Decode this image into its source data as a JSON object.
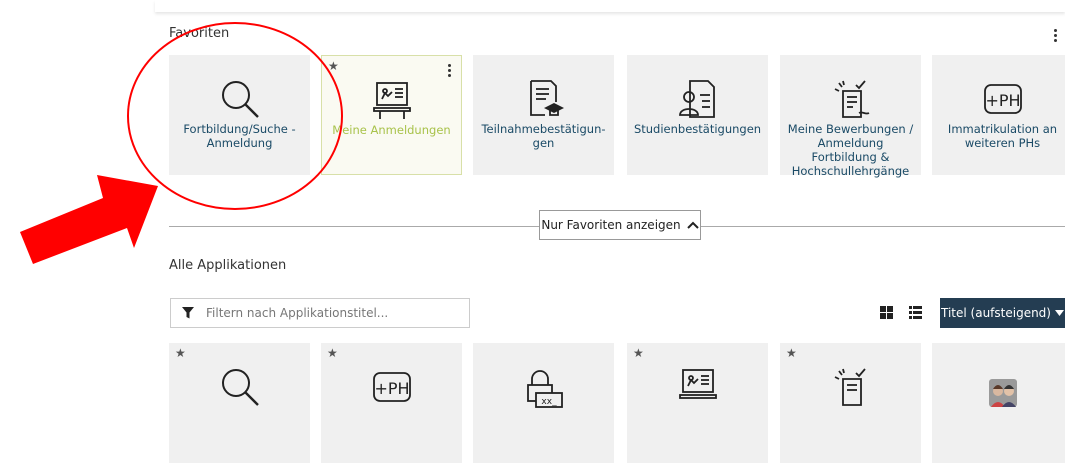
{
  "favorites": {
    "title": "Favoriten",
    "tiles": [
      {
        "label": "Fortbildung/Suche - An­meldung",
        "icon": "magnifier-icon"
      },
      {
        "label": "Meine Anmeldungen",
        "icon": "presentation-board-icon"
      },
      {
        "label": "Teilnahmebestätigun­gen",
        "icon": "document-graduation-icon"
      },
      {
        "label": "Studienbestätigungen",
        "icon": "document-person-icon"
      },
      {
        "label": "Meine Bewerbungen / Anmeldung Fortbildung & Hochschullehrgänge",
        "icon": "application-hand-icon"
      },
      {
        "label": "Immatrikulation an weiteren PHs",
        "icon": "ph-plus-icon"
      }
    ],
    "toggle_label": "Nur Favoriten anzeigen"
  },
  "all_apps": {
    "title": "Alle Applikationen",
    "filter_placeholder": "Filtern nach Applikationstitel...",
    "sort_label": "Titel (aufsteigend)",
    "tiles": [
      {
        "icon": "magnifier-icon"
      },
      {
        "icon": "ph-plus-icon"
      },
      {
        "icon": "lock-password-icon"
      },
      {
        "icon": "presentation-board-icon"
      },
      {
        "icon": "application-hand-icon"
      },
      {
        "icon": "user-avatars-icon"
      }
    ]
  },
  "colors": {
    "accent": "#243d52",
    "tile_bg": "#f0f0f0",
    "label": "#1a4a66",
    "highlight": "#ff0000",
    "active_label": "#a8c24a"
  }
}
